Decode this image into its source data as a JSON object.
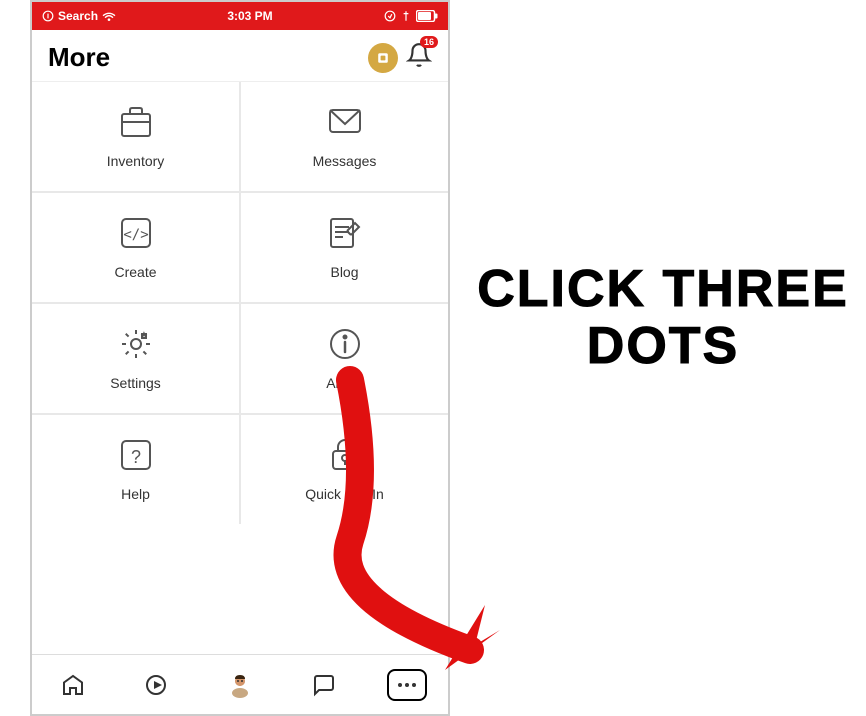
{
  "statusBar": {
    "left": "Search",
    "time": "3:03 PM",
    "right": "icons"
  },
  "header": {
    "title": "More",
    "notifCount": "16"
  },
  "menuItems": [
    {
      "id": "inventory",
      "label": "Inventory",
      "icon": "box"
    },
    {
      "id": "messages",
      "label": "Messages",
      "icon": "envelope"
    },
    {
      "id": "create",
      "label": "Create",
      "icon": "code"
    },
    {
      "id": "blog",
      "label": "Blog",
      "icon": "document"
    },
    {
      "id": "settings",
      "label": "Settings",
      "icon": "gear"
    },
    {
      "id": "about",
      "label": "About",
      "icon": "info"
    },
    {
      "id": "help",
      "label": "Help",
      "icon": "question"
    },
    {
      "id": "quicklogin",
      "label": "Quick Log In",
      "icon": "lock"
    }
  ],
  "bottomNav": [
    {
      "id": "home",
      "icon": "home",
      "active": false
    },
    {
      "id": "play",
      "icon": "play",
      "active": false
    },
    {
      "id": "avatar",
      "icon": "avatar",
      "active": false
    },
    {
      "id": "chat",
      "icon": "chat",
      "active": false
    },
    {
      "id": "more",
      "icon": "dots",
      "active": true
    }
  ],
  "annotation": {
    "line1": "CLICK THREE",
    "line2": "DOTS"
  }
}
